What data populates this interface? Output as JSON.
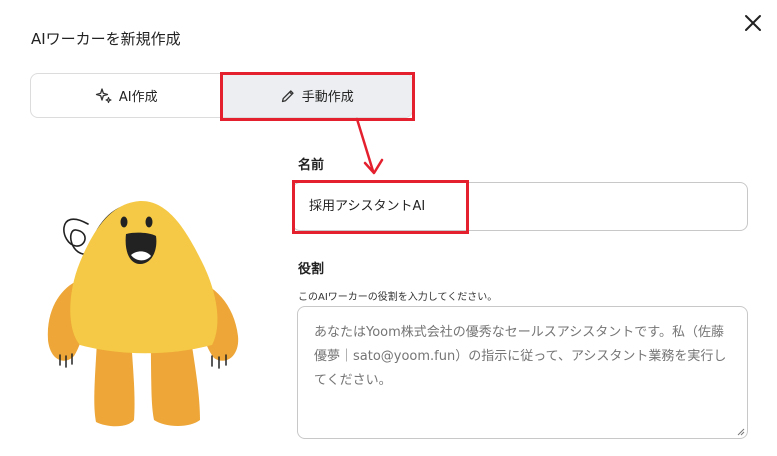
{
  "dialog": {
    "title": "AIワーカーを新規作成"
  },
  "tabs": [
    {
      "label": "AI作成",
      "icon": "sparkle-icon"
    },
    {
      "label": "手動作成",
      "icon": "pencil-icon"
    }
  ],
  "form": {
    "name_label": "名前",
    "name_value": "採用アシスタントAI",
    "role_label": "役割",
    "role_helper": "このAIワーカーの役割を入力してください。",
    "role_placeholder": "あなたはYoom株式会社の優秀なセールスアシスタントです。私（佐藤優夢｜sato@yoom.fun）の指示に従って、アシスタント業務を実行してください。"
  },
  "colors": {
    "highlight": "#e4202e",
    "mascot": "#f5c945",
    "mascot_limbs": "#eda637",
    "active_tab": "#eceef1"
  }
}
